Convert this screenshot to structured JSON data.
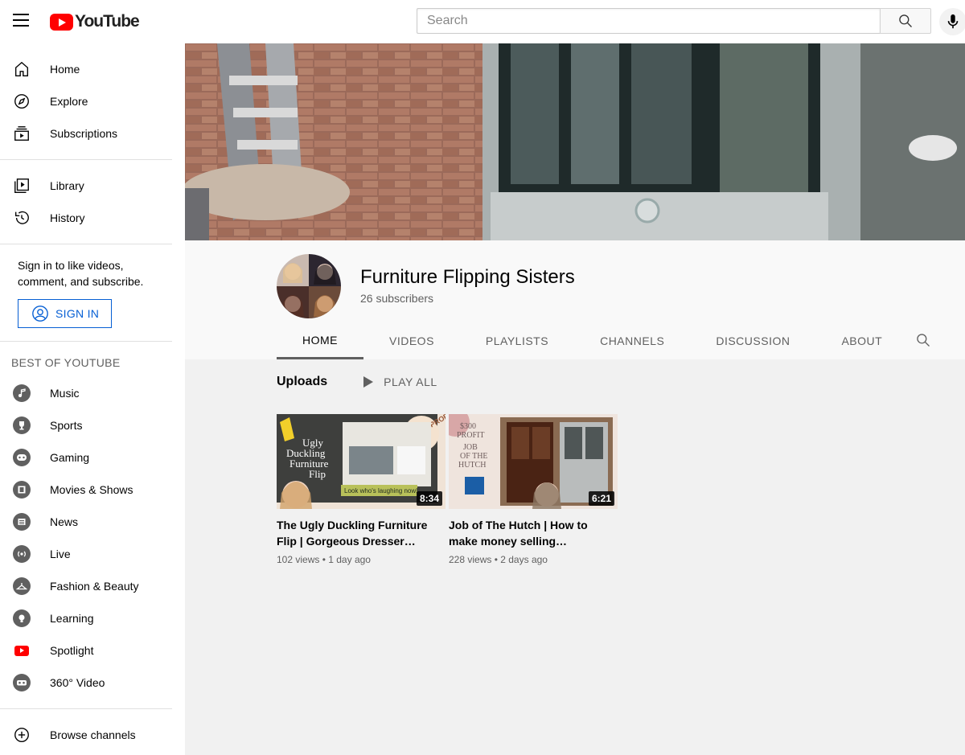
{
  "header": {
    "logo_text": "YouTube",
    "search_placeholder": "Search"
  },
  "sidebar": {
    "primary": [
      {
        "label": "Home",
        "icon": "home-icon"
      },
      {
        "label": "Explore",
        "icon": "compass-icon"
      },
      {
        "label": "Subscriptions",
        "icon": "subscriptions-icon"
      }
    ],
    "secondary": [
      {
        "label": "Library",
        "icon": "library-icon"
      },
      {
        "label": "History",
        "icon": "history-icon"
      }
    ],
    "signin_prompt": "Sign in to like videos, comment, and subscribe.",
    "signin_button": "SIGN IN",
    "best_of_title": "BEST OF YOUTUBE",
    "best_of": [
      {
        "label": "Music",
        "icon": "music-icon"
      },
      {
        "label": "Sports",
        "icon": "trophy-icon"
      },
      {
        "label": "Gaming",
        "icon": "gamepad-icon"
      },
      {
        "label": "Movies & Shows",
        "icon": "film-icon"
      },
      {
        "label": "News",
        "icon": "newspaper-icon"
      },
      {
        "label": "Live",
        "icon": "live-icon"
      },
      {
        "label": "Fashion & Beauty",
        "icon": "hanger-icon"
      },
      {
        "label": "Learning",
        "icon": "lightbulb-icon"
      },
      {
        "label": "Spotlight",
        "icon": "youtube-icon"
      },
      {
        "label": "360° Video",
        "icon": "vr-icon"
      }
    ],
    "browse_channels": "Browse channels"
  },
  "channel": {
    "name": "Furniture Flipping Sisters",
    "subscribers": "26 subscribers",
    "tabs": [
      "HOME",
      "VIDEOS",
      "PLAYLISTS",
      "CHANNELS",
      "DISCUSSION",
      "ABOUT"
    ],
    "active_tab": "HOME"
  },
  "uploads": {
    "title": "Uploads",
    "play_all": "PLAY ALL",
    "videos": [
      {
        "title": "The Ugly Duckling Furniture Flip | Gorgeous Dresser…",
        "views": "102 views",
        "age": "1 day ago",
        "duration": "8:34",
        "thumb_text": [
          "Ugly",
          "Duckling",
          "Furniture",
          "Flip"
        ],
        "thumb_badge": "$250 PROFIT",
        "thumb_caption": "Look who's laughing now!"
      },
      {
        "title": "Job of The Hutch | How to make money selling…",
        "views": "228 views",
        "age": "2 days ago",
        "duration": "6:21",
        "thumb_text": [
          "$300",
          "PROFIT",
          "JOB",
          "OF THE",
          "HUTCH"
        ]
      }
    ]
  },
  "colors": {
    "brand_red": "#ff0000",
    "link_blue": "#065fd4",
    "page_bg": "#f1f1f1"
  }
}
